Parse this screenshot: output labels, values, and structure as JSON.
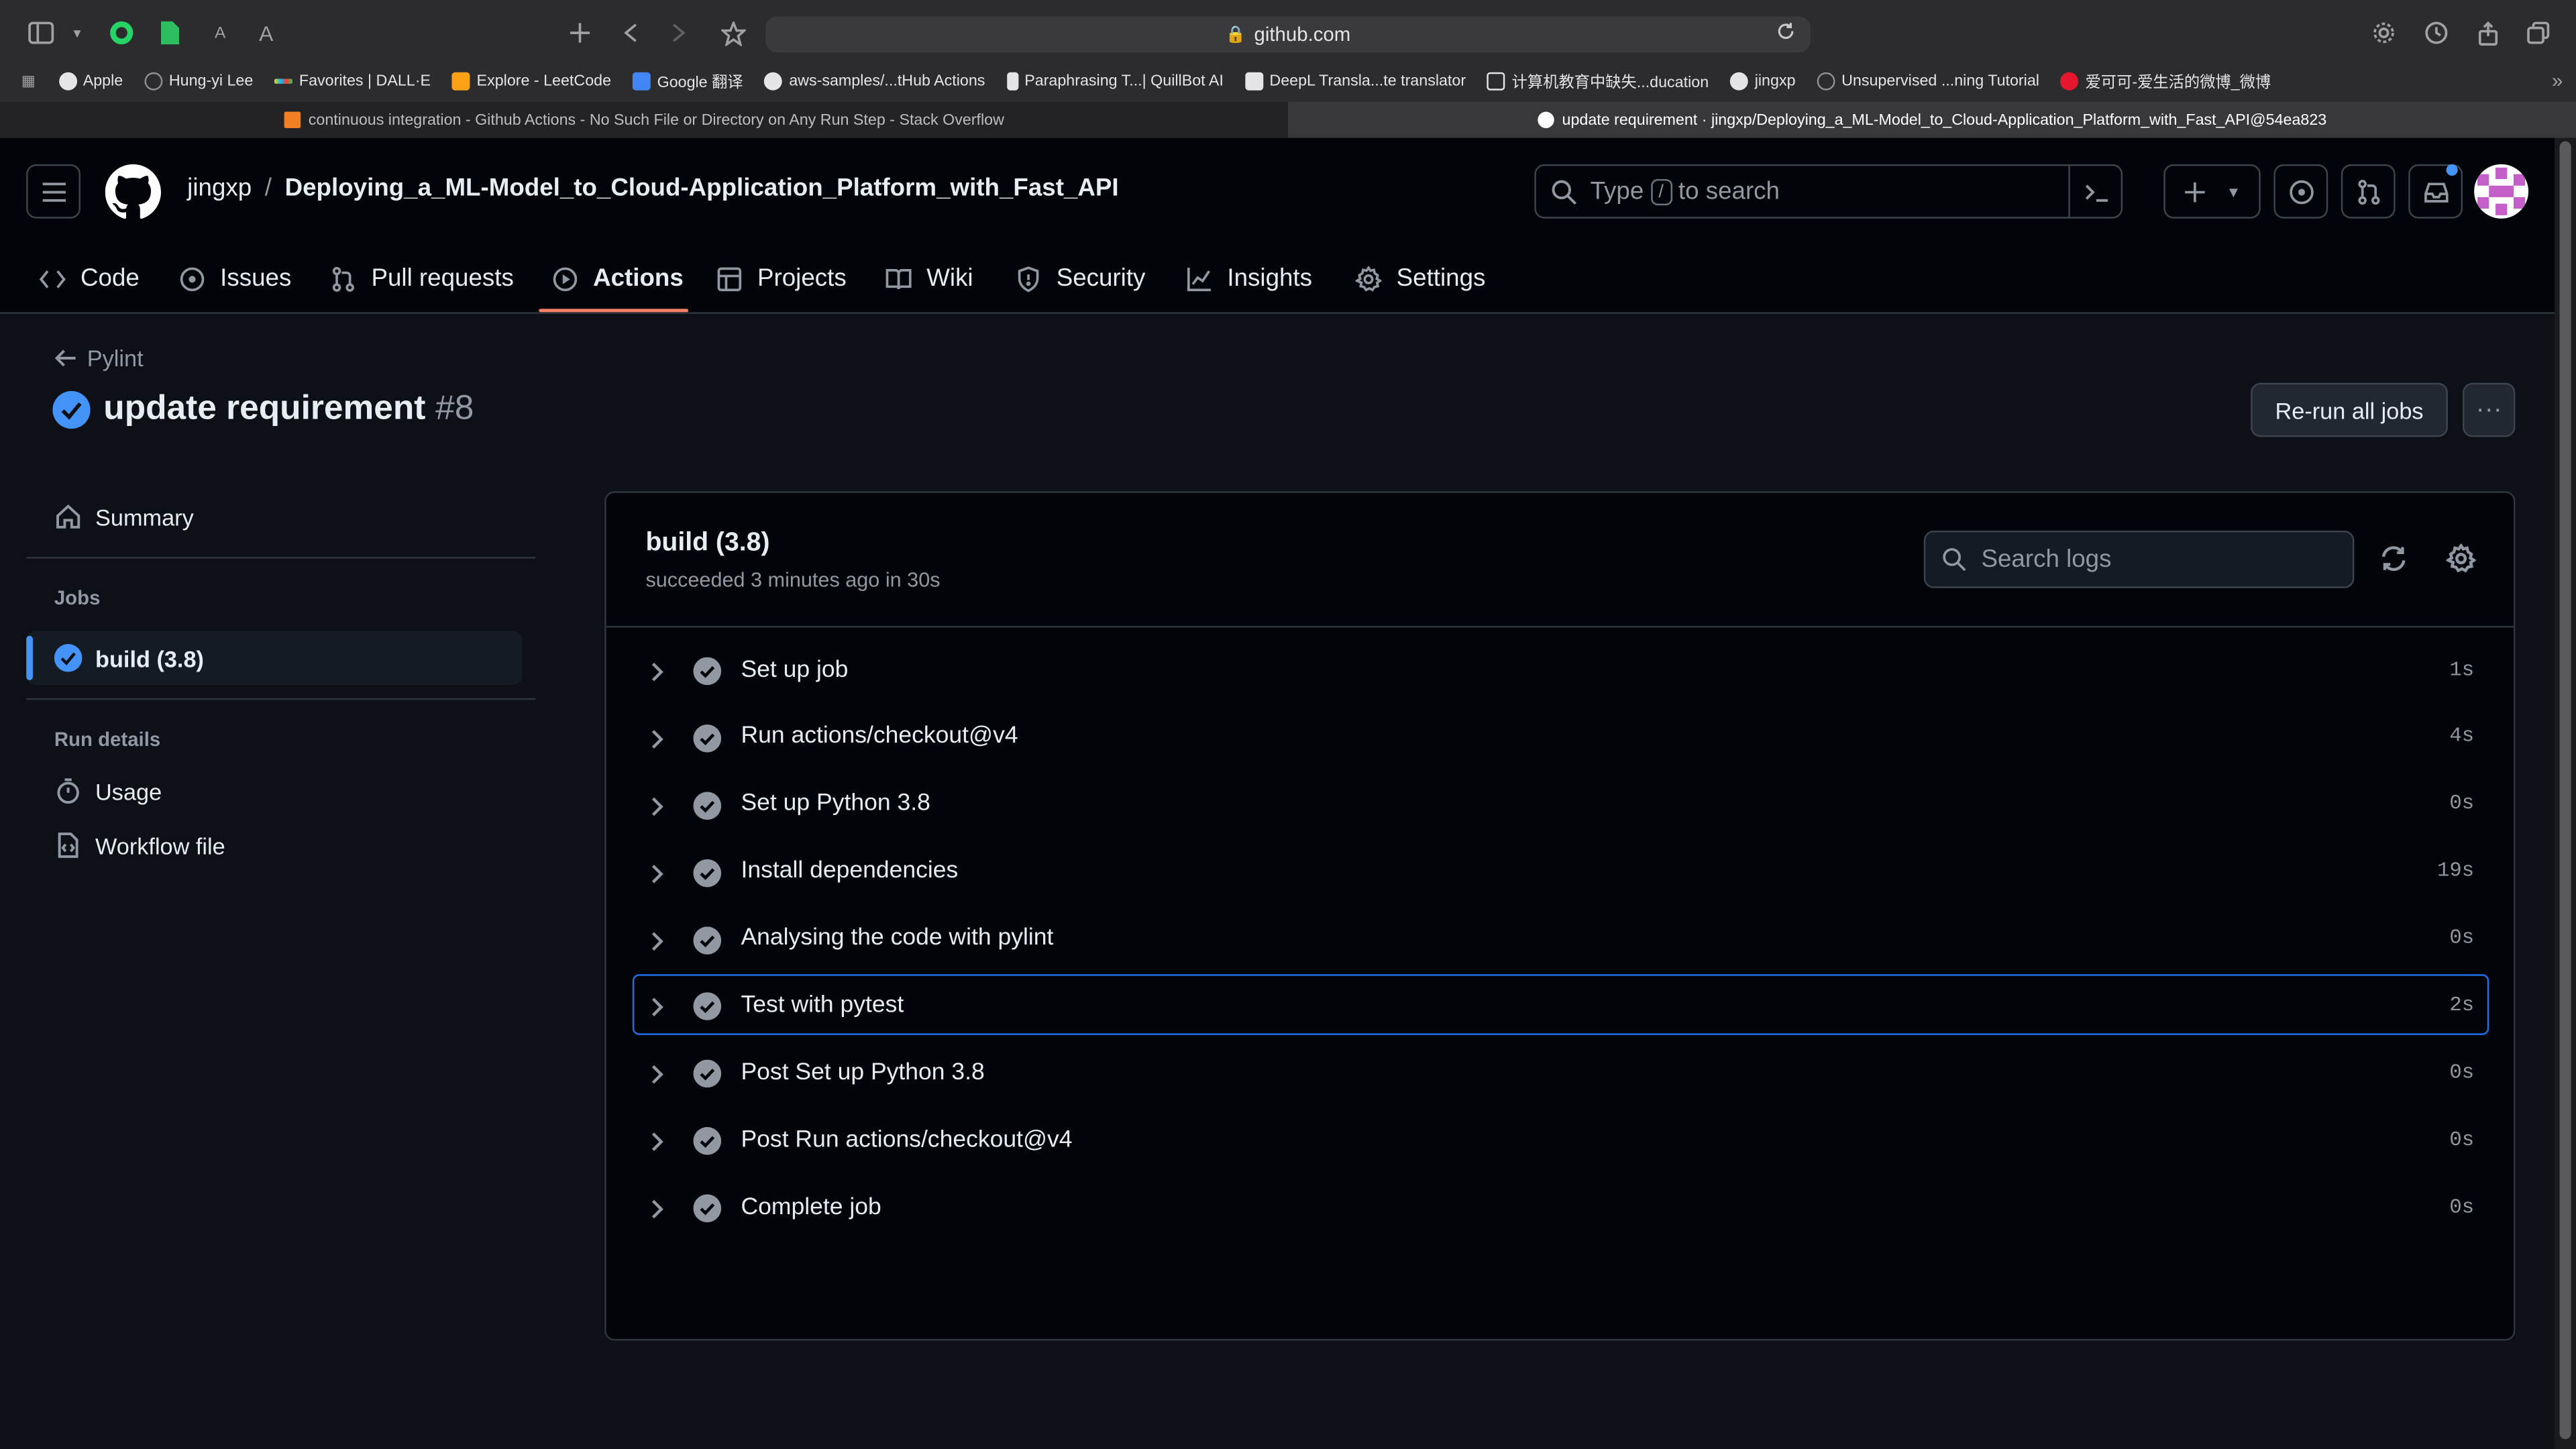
{
  "browser": {
    "url": "github.com",
    "bookmarks": [
      {
        "label": "Apple"
      },
      {
        "label": "Hung-yi Lee"
      },
      {
        "label": "Favorites | DALL·E"
      },
      {
        "label": "Explore - LeetCode"
      },
      {
        "label": "Google 翻译"
      },
      {
        "label": "aws-samples/...tHub Actions"
      },
      {
        "label": "Paraphrasing T...| QuillBot AI"
      },
      {
        "label": "DeepL Transla...te translator"
      },
      {
        "label": "计算机教育中缺失...ducation"
      },
      {
        "label": "jingxp"
      },
      {
        "label": "Unsupervised ...ning Tutorial"
      },
      {
        "label": "爱可可-爱生活的微博_微博"
      }
    ],
    "tabs": [
      {
        "label": "continuous integration - Github Actions - No Such File or Directory on Any Run Step - Stack Overflow",
        "active": false
      },
      {
        "label": "update requirement · jingxp/Deploying_a_ML-Model_to_Cloud-Application_Platform_with_Fast_API@54ea823",
        "active": true
      }
    ]
  },
  "header": {
    "owner": "jingxp",
    "separator": "/",
    "repo": "Deploying_a_ML-Model_to_Cloud-Application_Platform_with_Fast_API",
    "search_prefix": "Type",
    "search_key": "/",
    "search_suffix": "to search"
  },
  "repo_nav": [
    {
      "label": "Code",
      "icon": "code-icon"
    },
    {
      "label": "Issues",
      "icon": "issue-icon"
    },
    {
      "label": "Pull requests",
      "icon": "pull-request-icon"
    },
    {
      "label": "Actions",
      "icon": "play-icon",
      "active": true
    },
    {
      "label": "Projects",
      "icon": "table-icon"
    },
    {
      "label": "Wiki",
      "icon": "book-icon"
    },
    {
      "label": "Security",
      "icon": "shield-icon"
    },
    {
      "label": "Insights",
      "icon": "graph-icon"
    },
    {
      "label": "Settings",
      "icon": "gear-icon"
    }
  ],
  "run": {
    "workflow": "Pylint",
    "title": "update requirement",
    "number": "#8",
    "rerun_label": "Re-run all jobs",
    "more_label": "···"
  },
  "sidebar": {
    "summary": "Summary",
    "jobs_heading": "Jobs",
    "job": "build (3.8)",
    "run_details_heading": "Run details",
    "usage": "Usage",
    "workflow_file": "Workflow file"
  },
  "job": {
    "name": "build (3.8)",
    "status": "succeeded 3 minutes ago in 30s",
    "search_placeholder": "Search logs",
    "steps": [
      {
        "label": "Set up job",
        "duration": "1s"
      },
      {
        "label": "Run actions/checkout@v4",
        "duration": "4s"
      },
      {
        "label": "Set up Python 3.8",
        "duration": "0s"
      },
      {
        "label": "Install dependencies",
        "duration": "19s"
      },
      {
        "label": "Analysing the code with pylint",
        "duration": "0s"
      },
      {
        "label": "Test with pytest",
        "duration": "2s",
        "focused": true
      },
      {
        "label": "Post Set up Python 3.8",
        "duration": "0s"
      },
      {
        "label": "Post Run actions/checkout@v4",
        "duration": "0s"
      },
      {
        "label": "Complete job",
        "duration": "0s"
      }
    ]
  },
  "colors": {
    "success": "#1f6feb",
    "focus": "#1f6feb",
    "active_underline": "#f78166",
    "background": "#0d1117"
  }
}
